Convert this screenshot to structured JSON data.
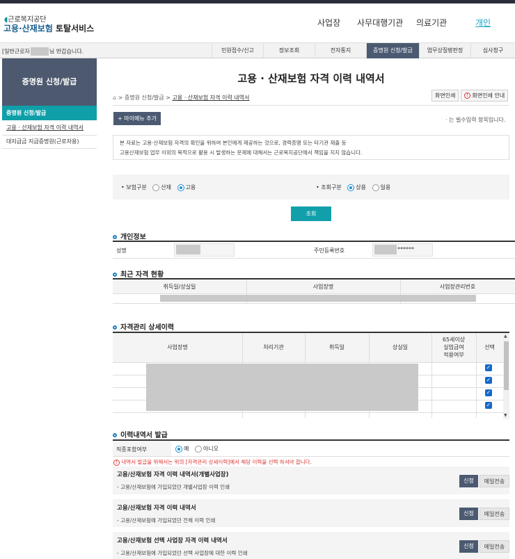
{
  "header": {
    "logo_sub": "근로복지공단",
    "logo_main_a": "고용·산재보험",
    "logo_main_b": "토탈서비스",
    "gnb": [
      "사업장",
      "사무대행기관",
      "의료기관",
      "개인"
    ]
  },
  "menubar": {
    "welcome_prefix": "[일반근로자",
    "welcome_suffix": "님 반갑습니다.",
    "items": [
      "민원접수/신고",
      "정보조회",
      "전자통지",
      "증명원 신청/발급",
      "업무상질병판정",
      "심사청구"
    ]
  },
  "lnb": {
    "title": "증명원 신청/발급",
    "selected": "증명원 신청/발급",
    "items": [
      "고용 · 산재보험 자격 이력 내역서",
      "대지급금 지급증명원(근로자용)"
    ]
  },
  "page": {
    "title": "고용 · 산재보험 자격 이력 내역서",
    "breadcrumb": [
      "증명원 신청/발급",
      "고용 · 산재보험 자격 이력 내역서"
    ],
    "print_btn": "화면인쇄",
    "print_guide_btn": "화면인쇄 안내",
    "mymenu_btn": "+ 마이메뉴 추가",
    "required_note": "· 는 필수입력 항목입니다.",
    "notice_line1": "본 자료는 고용·산재보험 자격의 확인을 위하여 본인에게 제공하는 것으로, 경력증명 또는 타기관 제출 등",
    "notice_line2": "고용산재보험 업무 이외의 목적으로 활용 시 발생하는 문제에 대해서는 근로복지공단에서 책임을 지지 않습니다."
  },
  "search": {
    "insurance_label": "• 보험구분",
    "insurance_options": [
      "산재",
      "고용"
    ],
    "insurance_selected": "고용",
    "query_label": "• 조회구분",
    "query_options": [
      "상용",
      "일용"
    ],
    "query_selected": "상용",
    "query_btn": "조회"
  },
  "personal": {
    "section": "개인정보",
    "name_label": "성명",
    "rrn_label": "주민등록번호",
    "rrn_suffix": "******"
  },
  "recent": {
    "section": "최근 자격 현황",
    "headers": [
      "취득일/상실일",
      "사업장명",
      "사업장관리번호"
    ]
  },
  "history": {
    "section": "자격관리 상세이력",
    "headers": [
      "사업장명",
      "처리기관",
      "취득일",
      "상실일",
      "65세이상",
      "실업급여",
      "적용여부",
      "선택"
    ],
    "rows_checked": [
      true,
      true,
      true,
      true
    ]
  },
  "issue": {
    "section": "이력내역서 발급",
    "job_label": "직종포함여부",
    "job_options": [
      "예",
      "아니오"
    ],
    "job_selected": "예",
    "warning": "내역서 발급을 위해서는 위의 [자격관리 상세이력]에서 해당 이력을 선택 하셔야 합니다.",
    "apply_label": "신청",
    "mail_label": "메일전송",
    "items": [
      {
        "title": "고용/산재보험 자격 이력 내역서(개별사업장)",
        "desc": "- 고용/산재보험에 가입되었던 개별사업장 이력 인쇄"
      },
      {
        "title": "고용/산재보험 자격 이력 내역서",
        "desc": "- 고용/산재보험에 가입되었던 전체 이력 인쇄"
      },
      {
        "title": "고용/산재보험 선택 사업장 자격 이력 내역서",
        "desc": "- 고용/산재보험에 가입되었던 선택 사업장에 대한 이력 인쇄"
      }
    ]
  },
  "colors": {
    "accent": "#0e9fa8",
    "nav_dark": "#4b5a71",
    "checkbox": "#1569c7"
  }
}
